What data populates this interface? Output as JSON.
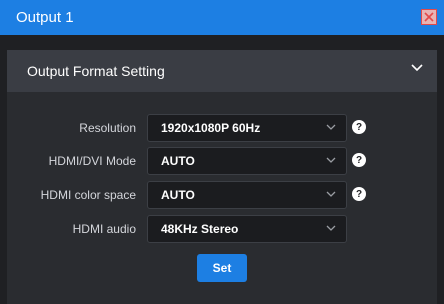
{
  "window": {
    "title": "Output 1"
  },
  "section": {
    "title": "Output Format Setting"
  },
  "fields": [
    {
      "label": "Resolution",
      "value": "1920x1080P 60Hz",
      "help": "?"
    },
    {
      "label": "HDMI/DVI Mode",
      "value": "AUTO",
      "help": "?"
    },
    {
      "label": "HDMI color space",
      "value": "AUTO",
      "help": "?"
    },
    {
      "label": "HDMI audio",
      "value": "48KHz Stereo"
    }
  ],
  "actions": {
    "set_label": "Set"
  },
  "colors": {
    "accent": "#1d7fe3",
    "background": "#1f2023",
    "panel": "#2a2c30",
    "header": "#3a3d44",
    "close_bg": "#e8b4b4",
    "close_border": "#e24a4a"
  },
  "icons": {
    "close": "close-icon",
    "section_toggle": "chevron-down-icon",
    "dropdown": "chevron-down-icon",
    "help": "help-icon"
  }
}
